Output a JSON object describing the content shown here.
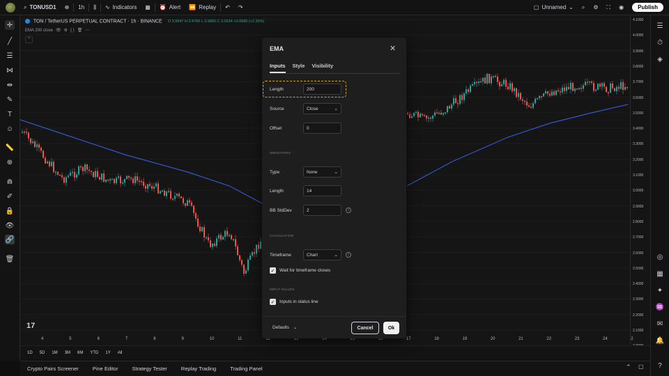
{
  "topbar": {
    "symbol": "TONUSD1",
    "interval": "1h",
    "indicators_label": "Indicators",
    "alert_label": "Alert",
    "replay_label": "Replay",
    "layout_name": "Unnamed",
    "publish_label": "Publish"
  },
  "legend": {
    "pair": "TON / TetherUS PERPETUAL CONTRACT · 1h · BINANCE",
    "ohlc": "O 3.9947 H 3.4785 L 3.9866 C 3.0534 +0.0689 (+2.35%)",
    "indicator": "EMA 200 close"
  },
  "yaxis_ticks": [
    "4.1000",
    "4.0000",
    "3.9000",
    "3.8000",
    "3.7000",
    "3.6000",
    "3.5000",
    "3.4000",
    "3.3000",
    "3.2000",
    "3.1000",
    "3.0000",
    "2.9000",
    "2.8000",
    "2.7000",
    "2.6000",
    "2.5000",
    "2.4000",
    "2.3000",
    "2.2000",
    "2.1000",
    "2.0000"
  ],
  "xaxis_ticks": [
    "4",
    "5",
    "6",
    "7",
    "8",
    "9",
    "10",
    "11",
    "12",
    "13",
    "14",
    "15",
    "16",
    "17",
    "18",
    "19",
    "20",
    "21",
    "22",
    "23",
    "24",
    "2"
  ],
  "range_buttons": [
    "1D",
    "5D",
    "1M",
    "3M",
    "6M",
    "YTD",
    "1Y",
    "All"
  ],
  "bottom_tabs": [
    "Crypto Pairs Screener",
    "Pine Editor",
    "Strategy Tester",
    "Replay Trading",
    "Trading Panel"
  ],
  "dialog": {
    "title": "EMA",
    "tabs": [
      "Inputs",
      "Style",
      "Visibility"
    ],
    "length_label": "Length",
    "length_value": "200",
    "source_label": "Source",
    "source_value": "Close",
    "offset_label": "Offset",
    "offset_value": "0",
    "smoothing_section": "SMOOTHING",
    "type_label": "Type",
    "type_value": "None",
    "smooth_length_label": "Length",
    "smooth_length_value": "14",
    "bb_label": "BB StdDev",
    "bb_value": "2",
    "calculation_section": "CALCULATION",
    "timeframe_label": "Timeframe",
    "timeframe_value": "Chart",
    "wait_label": "Wait for timeframe closes",
    "input_values_section": "INPUT VALUES",
    "status_line_label": "Inputs in status line",
    "defaults_label": "Defaults",
    "cancel_label": "Cancel",
    "ok_label": "Ok"
  },
  "colors": {
    "up": "#26a69a",
    "down": "#ef5350",
    "ema": "#3557c9",
    "highlight": "#d8a520"
  }
}
